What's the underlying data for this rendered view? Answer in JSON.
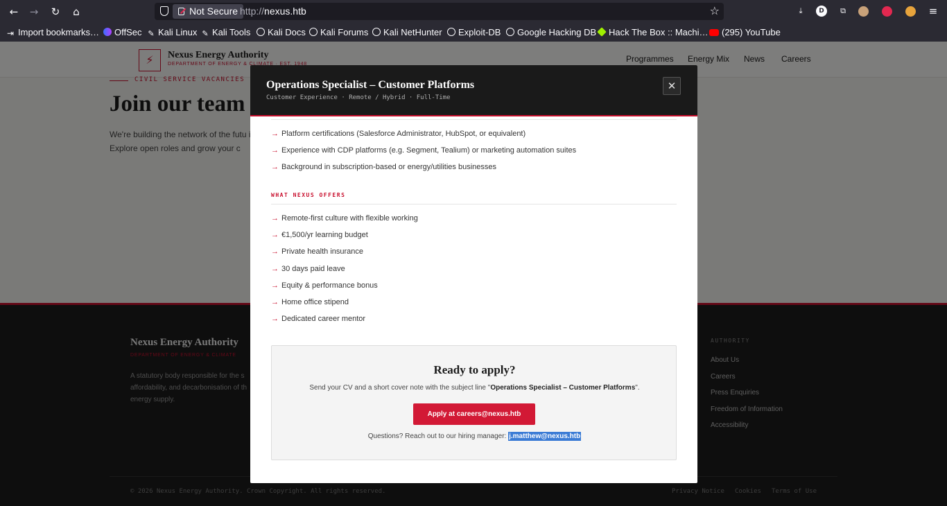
{
  "browser": {
    "not_secure": "Not Secure",
    "url_proto": "http://",
    "url_host": "nexus.htb",
    "profile_initial": "D",
    "bookmarks": [
      {
        "label": "Import bookmarks…",
        "icon": "import-icon"
      },
      {
        "label": "OffSec",
        "icon": "offsec-icon"
      },
      {
        "label": "Kali Linux",
        "icon": "kali-icon"
      },
      {
        "label": "Kali Tools",
        "icon": "kali-icon"
      },
      {
        "label": "Kali Docs",
        "icon": "globe-icon"
      },
      {
        "label": "Kali Forums",
        "icon": "globe-icon"
      },
      {
        "label": "Kali NetHunter",
        "icon": "globe-icon"
      },
      {
        "label": "Exploit-DB",
        "icon": "globe-icon"
      },
      {
        "label": "Google Hacking DB",
        "icon": "globe-icon"
      },
      {
        "label": "Hack The Box :: Machi…",
        "icon": "htb-icon"
      },
      {
        "label": "(295) YouTube",
        "icon": "youtube-icon"
      }
    ]
  },
  "site": {
    "logo_name": "Nexus Energy Authority",
    "logo_sub": "DEPARTMENT OF ENERGY & CLIMATE · EST. 1948",
    "nav": [
      "Programmes",
      "Energy Mix",
      "News",
      "Careers"
    ],
    "hero_eyebrow": "CIVIL SERVICE VACANCIES",
    "hero_title": "Join our team",
    "hero_text": "We're building the network of the futu it. Explore open roles and grow your c"
  },
  "footer": {
    "name": "Nexus Energy Authority",
    "sub": "DEPARTMENT OF ENERGY & CLIMATE",
    "desc": "A statutory body responsible for the s affordability, and decarbonisation of th energy supply.",
    "col_title": "AUTHORITY",
    "links": [
      "About Us",
      "Careers",
      "Press Enquiries",
      "Freedom of Information",
      "Accessibility"
    ],
    "copyright": "© 2026 Nexus Energy Authority. Crown Copyright. All rights reserved.",
    "legal": [
      "Privacy Notice",
      "Cookies",
      "Terms of Use"
    ]
  },
  "modal": {
    "title": "Operations Specialist – Customer Platforms",
    "meta": "Customer Experience · Remote / Hybrid · Full-Time",
    "close_label": "✕",
    "preferred": [
      "Platform certifications (Salesforce Administrator, HubSpot, or equivalent)",
      "Experience with CDP platforms (e.g. Segment, Tealium) or marketing automation suites",
      "Background in subscription-based or energy/utilities businesses"
    ],
    "offers_title": "WHAT NEXUS OFFERS",
    "offers": [
      "Remote-first culture with flexible working",
      "€1,500/yr learning budget",
      "Private health insurance",
      "30 days paid leave",
      "Equity & performance bonus",
      "Home office stipend",
      "Dedicated career mentor"
    ],
    "apply": {
      "title": "Ready to apply?",
      "text_before": "Send your CV and a short cover note with the subject line \"",
      "text_subject": "Operations Specialist – Customer Platforms",
      "text_after": "\".",
      "button": "Apply at careers@nexus.htb",
      "question": "Questions? Reach out to our hiring manager:",
      "manager_email": "j.matthew@nexus.htb"
    }
  },
  "colors": {
    "accent": "#c8102e",
    "selection": "#3a7bd5",
    "modal_header": "#1a1a1a"
  }
}
